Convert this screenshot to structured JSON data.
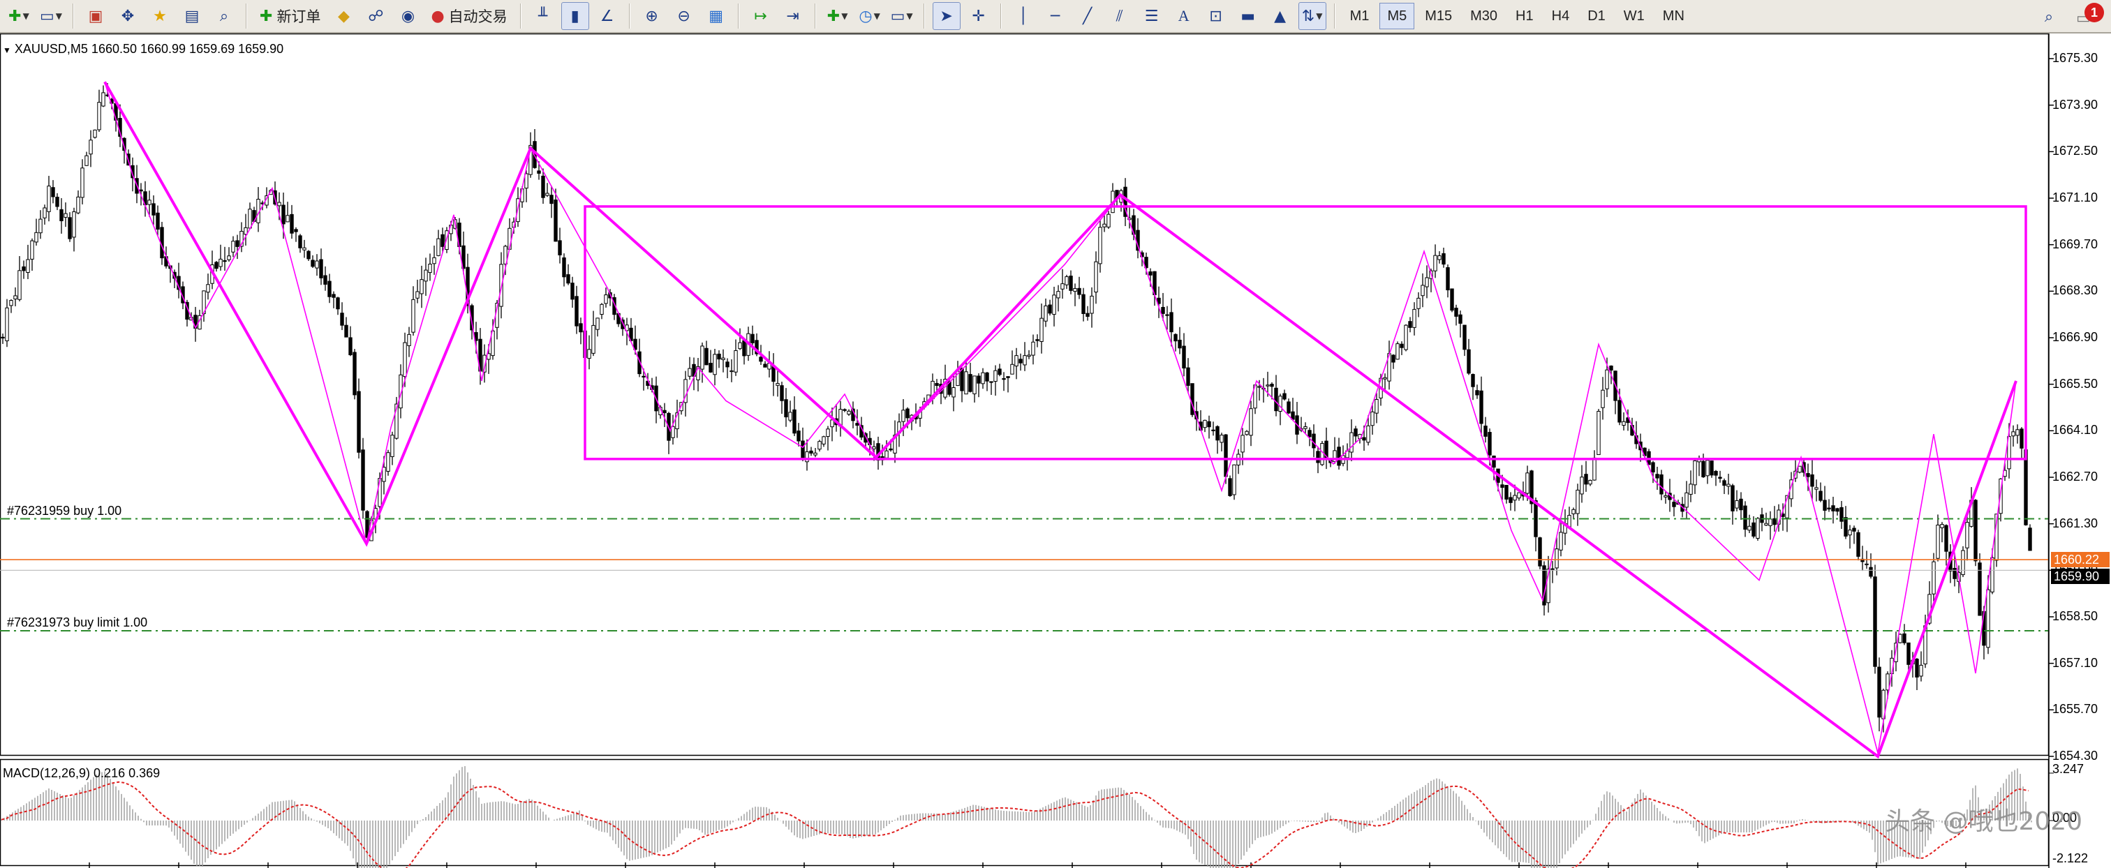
{
  "toolbar": {
    "new_order_label": "新订单",
    "auto_trading_label": "自动交易",
    "timeframes": [
      "M1",
      "M5",
      "M15",
      "M30",
      "H1",
      "H4",
      "D1",
      "W1",
      "MN"
    ],
    "active_timeframe": "M5",
    "notification_count": "1"
  },
  "chart": {
    "header": "XAUUSD,M5  1660.50 1660.99 1659.69 1659.90",
    "price_axis": [
      "1675.30",
      "1673.90",
      "1672.50",
      "1671.10",
      "1669.70",
      "1668.30",
      "1666.90",
      "1665.50",
      "1664.10",
      "1662.70",
      "1661.30",
      "1659.90",
      "1658.50",
      "1657.10",
      "1655.70",
      "1654.30"
    ],
    "current_price": "1659.90",
    "ask_price": "1660.22",
    "orders": [
      {
        "label": "#76231959 buy 1.00",
        "price": 1661.45
      },
      {
        "label": "#76231973 buy limit 1.00",
        "price": 1658.08
      }
    ],
    "box": {
      "top_price": 1670.85,
      "bottom_price": 1663.25
    },
    "colors": {
      "zigzag": "#ff00ff",
      "order_line": "#2e8b2e",
      "ask_line": "#f07020",
      "bid_tag": "#000000",
      "ask_tag": "#f07020",
      "macd_signal": "#e02020"
    }
  },
  "macd": {
    "header": "MACD(12,26,9) 0.216 0.369",
    "axis": [
      "3.247",
      "0.00",
      "-2.122"
    ]
  },
  "watermark": "头条 @哦也2020"
}
